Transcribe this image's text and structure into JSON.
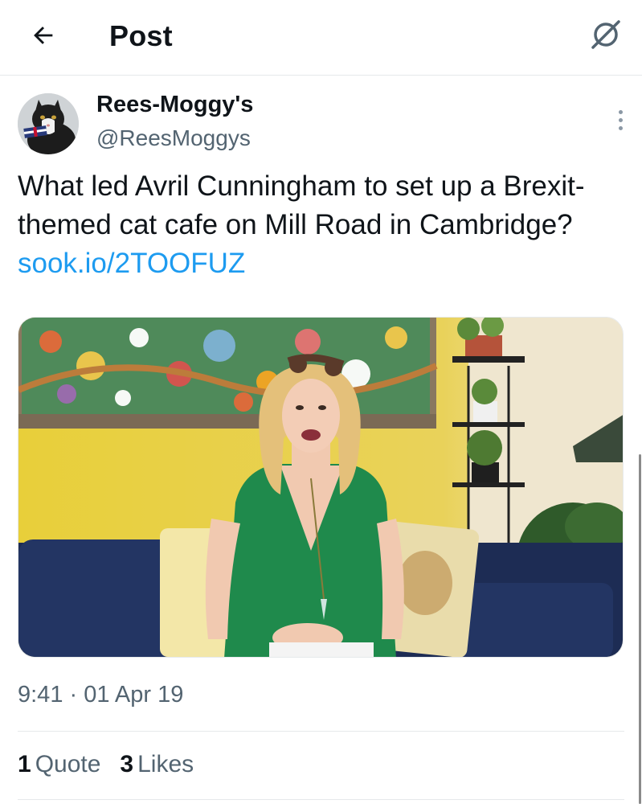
{
  "header": {
    "title": "Post",
    "back_icon": "arrow-left-icon",
    "grok_icon": "grok-icon"
  },
  "post": {
    "author": {
      "display_name": "Rees-Moggy's",
      "handle": "@ReesMoggys",
      "avatar_icon": "avatar-cat-photo"
    },
    "text": "What led Avril Cunningham to set up a Brexit-themed cat cafe on Mill Road in Cambridge?",
    "link": "sook.io/2TOOFUZ",
    "media_description": "photo-woman-green-top-on-sofa",
    "timestamp": "9:41 · 01 Apr 19",
    "stats": {
      "quotes_count": "1",
      "quotes_label": "Quote",
      "likes_count": "3",
      "likes_label": "Likes"
    }
  },
  "colors": {
    "link": "#1d9bf0",
    "secondary_text": "#536471",
    "primary_text": "#0f1419",
    "divider": "#e6e9eb"
  }
}
